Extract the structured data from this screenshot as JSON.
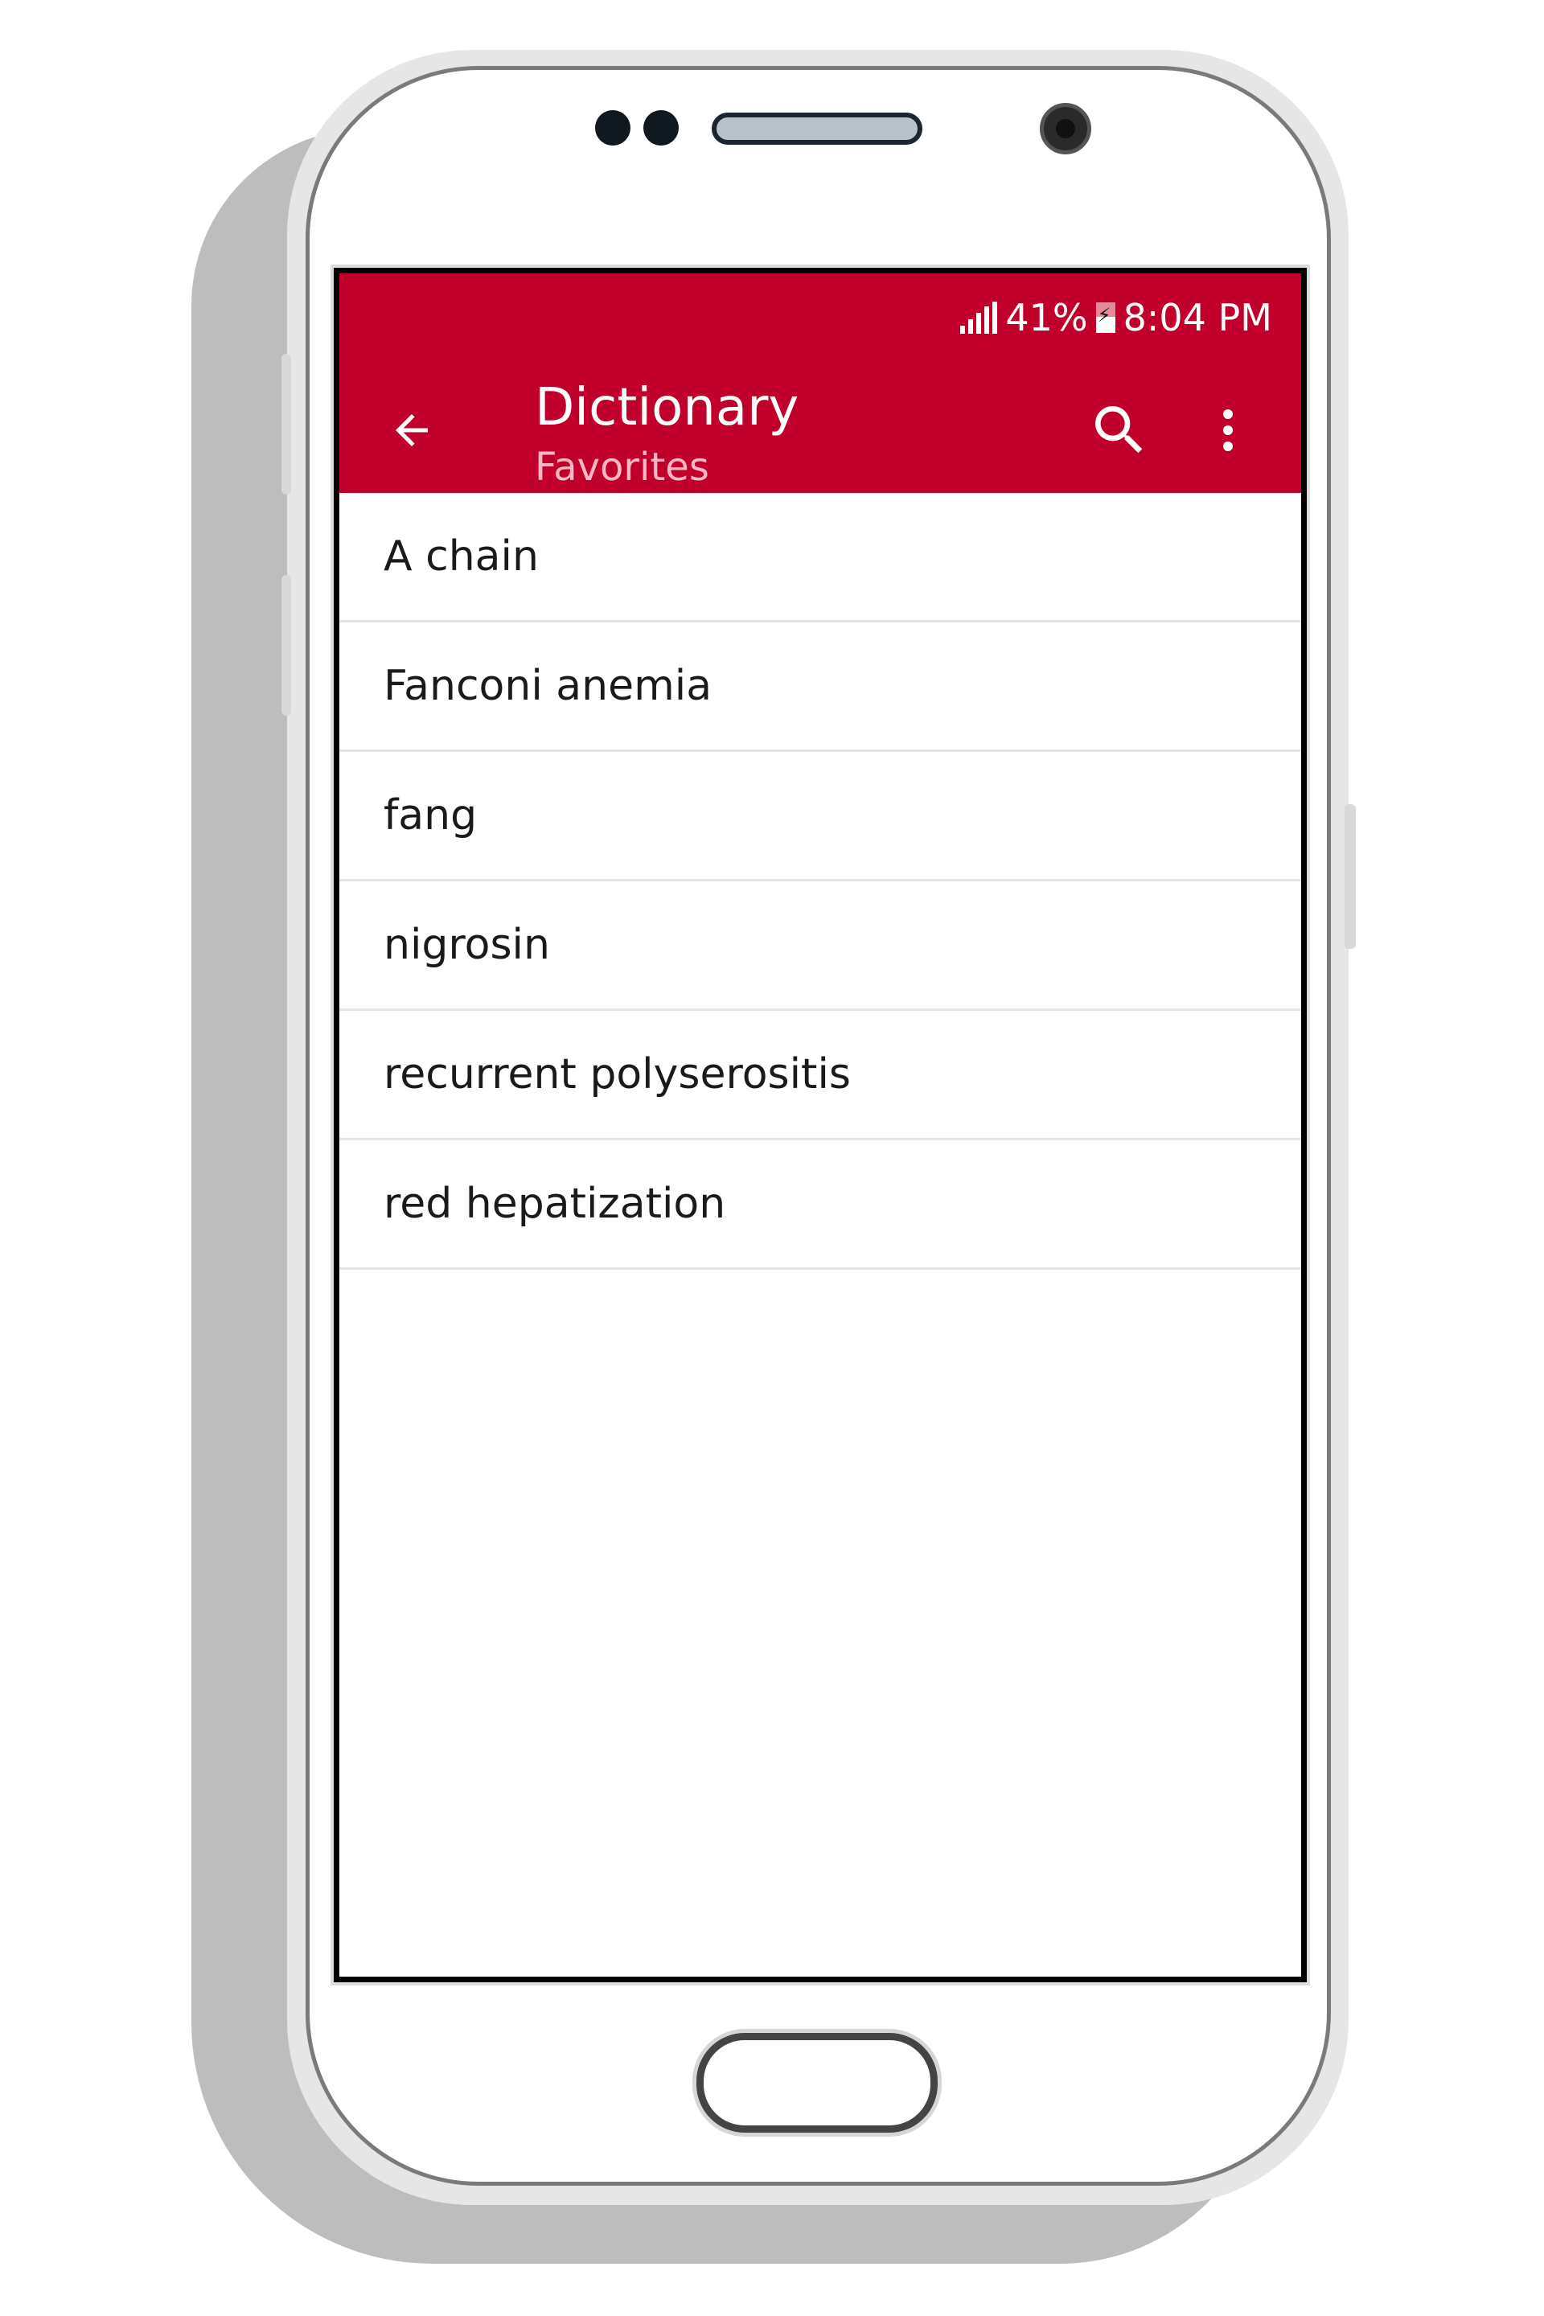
{
  "status_bar": {
    "signal_icon": "signal-bars-icon",
    "battery_percent": "41%",
    "battery_icon": "battery-charging-icon",
    "time": "8:04 PM"
  },
  "app_bar": {
    "back_icon": "arrow-back-icon",
    "title": "Dictionary",
    "subtitle": "Favorites",
    "search_icon": "search-icon",
    "more_icon": "more-vert-icon",
    "color": "#c0002a"
  },
  "favorites": [
    {
      "term": "A chain"
    },
    {
      "term": "Fanconi anemia"
    },
    {
      "term": "fang"
    },
    {
      "term": "nigrosin"
    },
    {
      "term": "recurrent polyserositis"
    },
    {
      "term": "red hepatization"
    }
  ]
}
